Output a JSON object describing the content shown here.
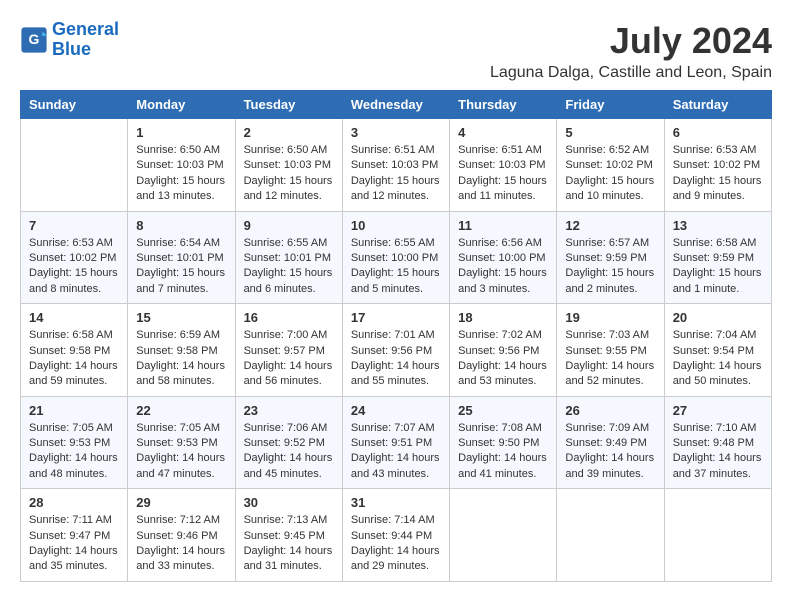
{
  "header": {
    "logo_line1": "General",
    "logo_line2": "Blue",
    "month_year": "July 2024",
    "location": "Laguna Dalga, Castille and Leon, Spain"
  },
  "days_of_week": [
    "Sunday",
    "Monday",
    "Tuesday",
    "Wednesday",
    "Thursday",
    "Friday",
    "Saturday"
  ],
  "weeks": [
    [
      {
        "day": "",
        "sunrise": "",
        "sunset": "",
        "daylight": ""
      },
      {
        "day": "1",
        "sunrise": "Sunrise: 6:50 AM",
        "sunset": "Sunset: 10:03 PM",
        "daylight": "Daylight: 15 hours and 13 minutes."
      },
      {
        "day": "2",
        "sunrise": "Sunrise: 6:50 AM",
        "sunset": "Sunset: 10:03 PM",
        "daylight": "Daylight: 15 hours and 12 minutes."
      },
      {
        "day": "3",
        "sunrise": "Sunrise: 6:51 AM",
        "sunset": "Sunset: 10:03 PM",
        "daylight": "Daylight: 15 hours and 12 minutes."
      },
      {
        "day": "4",
        "sunrise": "Sunrise: 6:51 AM",
        "sunset": "Sunset: 10:03 PM",
        "daylight": "Daylight: 15 hours and 11 minutes."
      },
      {
        "day": "5",
        "sunrise": "Sunrise: 6:52 AM",
        "sunset": "Sunset: 10:02 PM",
        "daylight": "Daylight: 15 hours and 10 minutes."
      },
      {
        "day": "6",
        "sunrise": "Sunrise: 6:53 AM",
        "sunset": "Sunset: 10:02 PM",
        "daylight": "Daylight: 15 hours and 9 minutes."
      }
    ],
    [
      {
        "day": "7",
        "sunrise": "Sunrise: 6:53 AM",
        "sunset": "Sunset: 10:02 PM",
        "daylight": "Daylight: 15 hours and 8 minutes."
      },
      {
        "day": "8",
        "sunrise": "Sunrise: 6:54 AM",
        "sunset": "Sunset: 10:01 PM",
        "daylight": "Daylight: 15 hours and 7 minutes."
      },
      {
        "day": "9",
        "sunrise": "Sunrise: 6:55 AM",
        "sunset": "Sunset: 10:01 PM",
        "daylight": "Daylight: 15 hours and 6 minutes."
      },
      {
        "day": "10",
        "sunrise": "Sunrise: 6:55 AM",
        "sunset": "Sunset: 10:00 PM",
        "daylight": "Daylight: 15 hours and 5 minutes."
      },
      {
        "day": "11",
        "sunrise": "Sunrise: 6:56 AM",
        "sunset": "Sunset: 10:00 PM",
        "daylight": "Daylight: 15 hours and 3 minutes."
      },
      {
        "day": "12",
        "sunrise": "Sunrise: 6:57 AM",
        "sunset": "Sunset: 9:59 PM",
        "daylight": "Daylight: 15 hours and 2 minutes."
      },
      {
        "day": "13",
        "sunrise": "Sunrise: 6:58 AM",
        "sunset": "Sunset: 9:59 PM",
        "daylight": "Daylight: 15 hours and 1 minute."
      }
    ],
    [
      {
        "day": "14",
        "sunrise": "Sunrise: 6:58 AM",
        "sunset": "Sunset: 9:58 PM",
        "daylight": "Daylight: 14 hours and 59 minutes."
      },
      {
        "day": "15",
        "sunrise": "Sunrise: 6:59 AM",
        "sunset": "Sunset: 9:58 PM",
        "daylight": "Daylight: 14 hours and 58 minutes."
      },
      {
        "day": "16",
        "sunrise": "Sunrise: 7:00 AM",
        "sunset": "Sunset: 9:57 PM",
        "daylight": "Daylight: 14 hours and 56 minutes."
      },
      {
        "day": "17",
        "sunrise": "Sunrise: 7:01 AM",
        "sunset": "Sunset: 9:56 PM",
        "daylight": "Daylight: 14 hours and 55 minutes."
      },
      {
        "day": "18",
        "sunrise": "Sunrise: 7:02 AM",
        "sunset": "Sunset: 9:56 PM",
        "daylight": "Daylight: 14 hours and 53 minutes."
      },
      {
        "day": "19",
        "sunrise": "Sunrise: 7:03 AM",
        "sunset": "Sunset: 9:55 PM",
        "daylight": "Daylight: 14 hours and 52 minutes."
      },
      {
        "day": "20",
        "sunrise": "Sunrise: 7:04 AM",
        "sunset": "Sunset: 9:54 PM",
        "daylight": "Daylight: 14 hours and 50 minutes."
      }
    ],
    [
      {
        "day": "21",
        "sunrise": "Sunrise: 7:05 AM",
        "sunset": "Sunset: 9:53 PM",
        "daylight": "Daylight: 14 hours and 48 minutes."
      },
      {
        "day": "22",
        "sunrise": "Sunrise: 7:05 AM",
        "sunset": "Sunset: 9:53 PM",
        "daylight": "Daylight: 14 hours and 47 minutes."
      },
      {
        "day": "23",
        "sunrise": "Sunrise: 7:06 AM",
        "sunset": "Sunset: 9:52 PM",
        "daylight": "Daylight: 14 hours and 45 minutes."
      },
      {
        "day": "24",
        "sunrise": "Sunrise: 7:07 AM",
        "sunset": "Sunset: 9:51 PM",
        "daylight": "Daylight: 14 hours and 43 minutes."
      },
      {
        "day": "25",
        "sunrise": "Sunrise: 7:08 AM",
        "sunset": "Sunset: 9:50 PM",
        "daylight": "Daylight: 14 hours and 41 minutes."
      },
      {
        "day": "26",
        "sunrise": "Sunrise: 7:09 AM",
        "sunset": "Sunset: 9:49 PM",
        "daylight": "Daylight: 14 hours and 39 minutes."
      },
      {
        "day": "27",
        "sunrise": "Sunrise: 7:10 AM",
        "sunset": "Sunset: 9:48 PM",
        "daylight": "Daylight: 14 hours and 37 minutes."
      }
    ],
    [
      {
        "day": "28",
        "sunrise": "Sunrise: 7:11 AM",
        "sunset": "Sunset: 9:47 PM",
        "daylight": "Daylight: 14 hours and 35 minutes."
      },
      {
        "day": "29",
        "sunrise": "Sunrise: 7:12 AM",
        "sunset": "Sunset: 9:46 PM",
        "daylight": "Daylight: 14 hours and 33 minutes."
      },
      {
        "day": "30",
        "sunrise": "Sunrise: 7:13 AM",
        "sunset": "Sunset: 9:45 PM",
        "daylight": "Daylight: 14 hours and 31 minutes."
      },
      {
        "day": "31",
        "sunrise": "Sunrise: 7:14 AM",
        "sunset": "Sunset: 9:44 PM",
        "daylight": "Daylight: 14 hours and 29 minutes."
      },
      {
        "day": "",
        "sunrise": "",
        "sunset": "",
        "daylight": ""
      },
      {
        "day": "",
        "sunrise": "",
        "sunset": "",
        "daylight": ""
      },
      {
        "day": "",
        "sunrise": "",
        "sunset": "",
        "daylight": ""
      }
    ]
  ]
}
